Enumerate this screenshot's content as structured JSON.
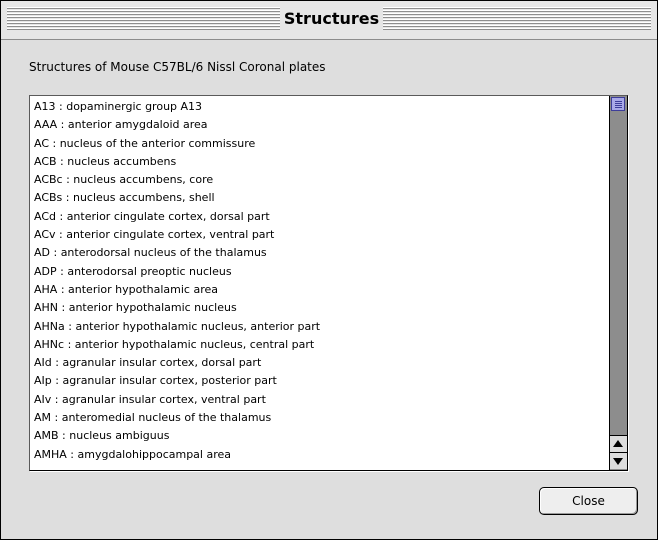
{
  "window": {
    "title": "Structures"
  },
  "dialog": {
    "heading": "Structures of Mouse C57BL/6 Nissl Coronal plates",
    "close_label": "Close"
  },
  "structures": [
    "A13 : dopaminergic group A13",
    "AAA : anterior amygdaloid area",
    "AC : nucleus of the anterior commissure",
    "ACB : nucleus accumbens",
    "ACBc : nucleus accumbens, core",
    "ACBs : nucleus accumbens, shell",
    "ACd : anterior cingulate cortex, dorsal part",
    "ACv : anterior cingulate cortex, ventral part",
    "AD : anterodorsal nucleus of the thalamus",
    "ADP : anterodorsal preoptic nucleus",
    "AHA : anterior hypothalamic area",
    "AHN : anterior hypothalamic nucleus",
    "AHNa : anterior hypothalamic nucleus, anterior part",
    "AHNc : anterior hypothalamic nucleus, central part",
    "AId : agranular insular cortex, dorsal part",
    "AIp : agranular insular cortex, posterior part",
    "AIv : agranular insular cortex, ventral part",
    "AM : anteromedial nucleus of the thalamus",
    "AMB : nucleus ambiguus",
    "AMHA : amygdalohippocampal area"
  ],
  "colors": {
    "window_bg": "#dedede",
    "scroll_track": "#8d8d8d",
    "scroll_thumb": "#a9a9e8"
  },
  "icons": {
    "scroll_up": "scroll-up-arrow-icon",
    "scroll_down": "scroll-down-arrow-icon"
  }
}
